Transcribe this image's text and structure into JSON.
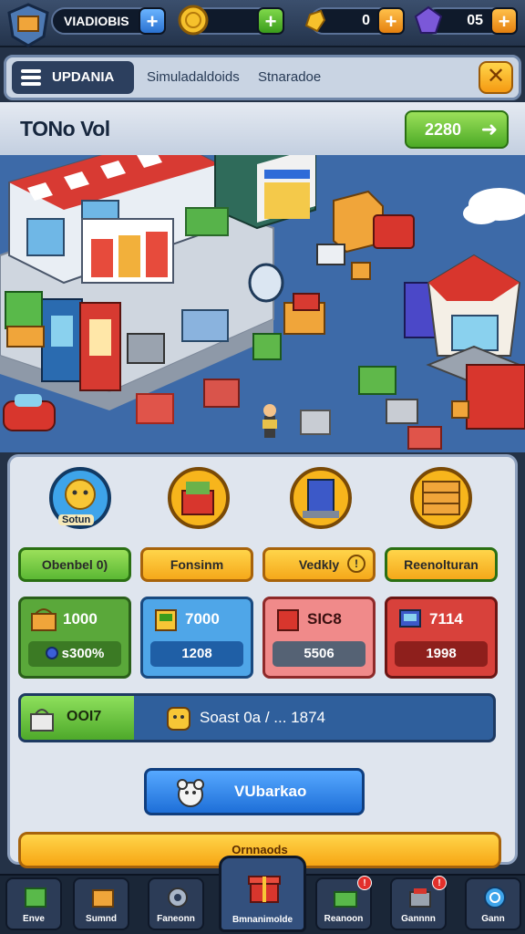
{
  "topbar": {
    "player_name": "VIADIOBIS",
    "coin_value": "",
    "gem_value": "0",
    "energy_value": "05",
    "plus_label": "+"
  },
  "header": {
    "tabs": [
      {
        "label": "UPDANIA",
        "active": true
      },
      {
        "label": "Simuladaldoids",
        "active": false
      },
      {
        "label": "Stnaradoe",
        "active": false
      }
    ],
    "close_label": "✕"
  },
  "store": {
    "title": "TONo Vol",
    "coin_button_value": "2280",
    "arrow": "➜"
  },
  "categories": [
    {
      "name": "Sotun",
      "button": "Obenbel 0)",
      "color": "#63c33a",
      "icon": "smiley-icon"
    },
    {
      "name": "",
      "button": "Fonsinm",
      "color": "#f7b51c",
      "icon": "cart-icon"
    },
    {
      "name": "",
      "button": "Vedkly",
      "color": "#f7b51c",
      "icon": "box-icon"
    },
    {
      "name": "",
      "button": "Reenolturan",
      "color": "#f7b51c",
      "icon": "shelf-icon"
    }
  ],
  "stats": [
    {
      "top": "1000",
      "bottom": "s300%",
      "color": "#5aa83a",
      "bar_color": "#3b7a24"
    },
    {
      "top": "7000",
      "bottom": "1208",
      "color": "#4fa6e8",
      "bar_color": "#1f5fa6"
    },
    {
      "top": "SIC8",
      "bottom": "5506",
      "color": "#f08a8a",
      "bar_color": "#556274"
    },
    {
      "top": "7114",
      "bottom": "1998",
      "color": "#d8413b",
      "bar_color": "#8e1f1c"
    }
  ],
  "progress": {
    "label": "OOI7",
    "text": "Soast 0a / ... 1874",
    "fraction": 0.24
  },
  "main_button": "VUbarkao",
  "yellow_bar": "Ornnaods",
  "bottom_nav": [
    {
      "label": "Enve",
      "icon": "crate-icon"
    },
    {
      "label": "Sumnd",
      "icon": "box-icon"
    },
    {
      "label": "Faneonn",
      "icon": "gear-icon"
    },
    {
      "label": "Bmnanimolde",
      "icon": "gift-icon"
    },
    {
      "label": "Reanoon",
      "icon": "cash-icon"
    },
    {
      "label": "Gannnn",
      "icon": "register-icon"
    },
    {
      "label": "Gann",
      "icon": "help-icon"
    }
  ],
  "colors": {
    "accent_green": "#4caa26",
    "accent_yellow": "#f7a614",
    "accent_blue": "#1e6fd8",
    "dark_navy": "#1a2637"
  }
}
